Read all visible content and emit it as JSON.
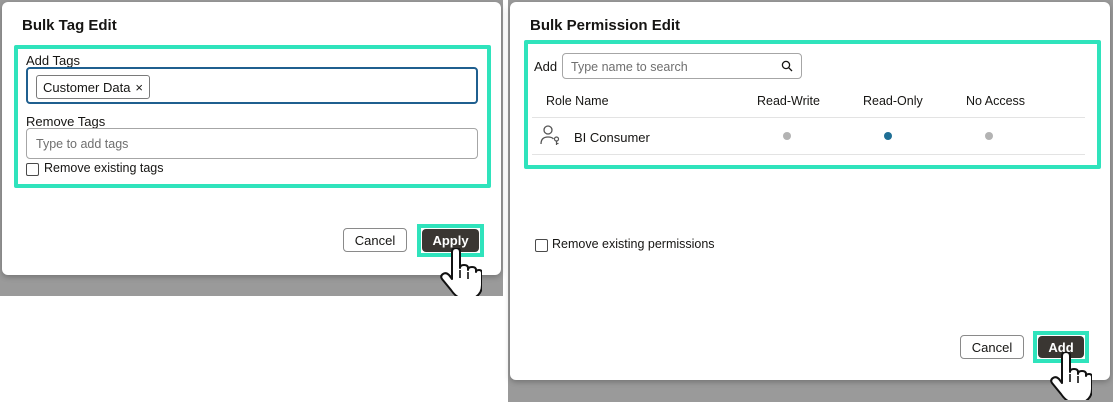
{
  "tag_dialog": {
    "title": "Bulk Tag Edit",
    "add_tags_label": "Add Tags",
    "tags": [
      {
        "label": "Customer Data",
        "remove_glyph": "×"
      }
    ],
    "remove_tags_label": "Remove Tags",
    "remove_tags_placeholder": "Type to add tags",
    "remove_existing_label": "Remove existing tags",
    "remove_existing_checked": false,
    "cancel_label": "Cancel",
    "apply_label": "Apply"
  },
  "permission_dialog": {
    "title": "Bulk Permission Edit",
    "add_label": "Add",
    "search_placeholder": "Type name to search",
    "search_icon": "search-icon",
    "columns": {
      "role": "Role Name",
      "read_write": "Read-Write",
      "read_only": "Read-Only",
      "no_access": "No Access"
    },
    "rows": [
      {
        "icon": "user-role-icon",
        "role": "BI Consumer",
        "selected": "read_only"
      }
    ],
    "remove_existing_label": "Remove existing permissions",
    "remove_existing_checked": false,
    "cancel_label": "Cancel",
    "add_button_label": "Add"
  },
  "colors": {
    "highlight": "#2fe3bc",
    "primary_button": "#3a3632",
    "selected_dot": "#1f6f95",
    "unselected_dot": "#b3b3b3",
    "focus_border": "#1f5f8f"
  }
}
